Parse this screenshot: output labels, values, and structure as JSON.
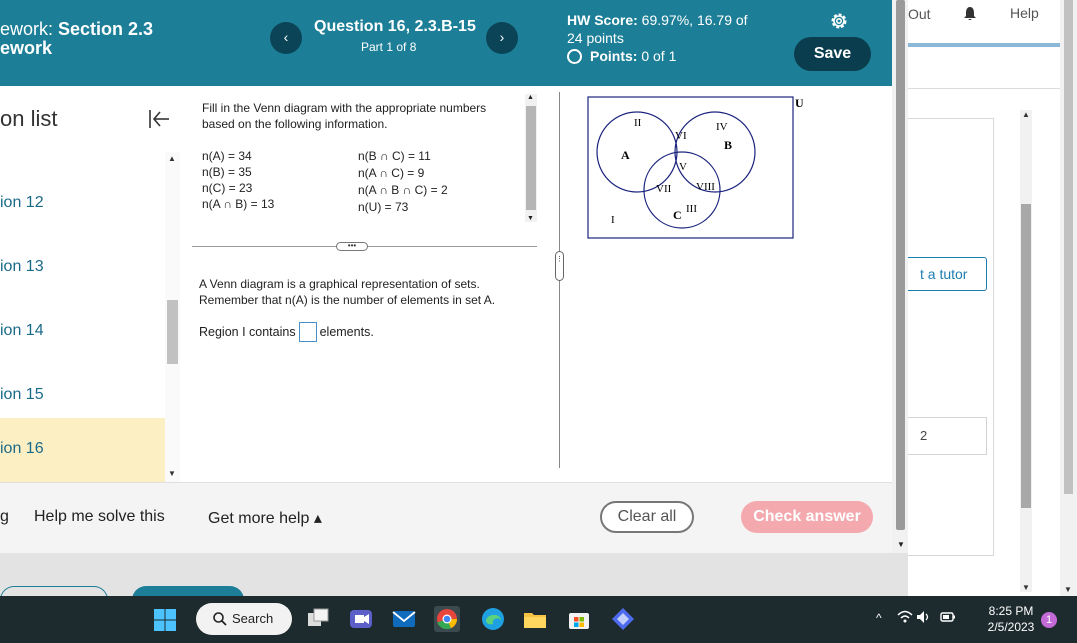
{
  "header": {
    "title_line1_prefix": "ework: ",
    "title_line1_section": "Section 2.3",
    "title_line2": "ework",
    "question_title": "Question 16, 2.3.B-15",
    "part": "Part 1 of 8",
    "prev_label": "‹",
    "next_label": "›",
    "hw_score_label": "HW Score:",
    "hw_score_value": " 69.97%, 16.79 of",
    "hw_points_total": "24 points",
    "points_label": "Points:",
    "points_value": " 0 of 1",
    "save_label": "Save"
  },
  "sidebar": {
    "title": "on list",
    "items": [
      {
        "label": "ion 12",
        "active": false
      },
      {
        "label": "ion 13",
        "active": false
      },
      {
        "label": "ion 14",
        "active": false
      },
      {
        "label": "ion 15",
        "active": false
      },
      {
        "label": "ion 16",
        "active": true
      }
    ]
  },
  "question": {
    "instruction_line1": "Fill in the Venn diagram with the appropriate numbers",
    "instruction_line2": "based on the following information.",
    "given_left": [
      "n(A) = 34",
      "n(B) = 35",
      "n(C) = 23",
      "n(A ∩ B) = 13"
    ],
    "given_right": [
      "n(B ∩ C) = 11",
      "n(A ∩ C) = 9",
      "n(A ∩ B ∩ C) = 2",
      "n(U) = 73"
    ],
    "more_label": "•••",
    "note_line1": "A Venn diagram is a graphical representation of sets.",
    "note_line2": "Remember that n(A) is the number of elements in set A.",
    "answer_prefix": "Region I contains",
    "answer_suffix": "elements.",
    "answer_value": ""
  },
  "venn": {
    "universe_label": "U",
    "set_labels": [
      "A",
      "B",
      "C"
    ],
    "regions": [
      "I",
      "II",
      "III",
      "IV",
      "V",
      "VI",
      "VII",
      "VIII"
    ]
  },
  "bottom": {
    "partial_left": "g",
    "help_solve": "Help me solve this",
    "more_help": "Get more help ▴",
    "clear_all": "Clear all",
    "check_answer": "Check answer"
  },
  "right_page": {
    "signout_partial": "Out",
    "help": "Help",
    "tutor_partial": "t a tutor",
    "box_partial": "2"
  },
  "taskbar": {
    "search_label": "Search",
    "time": "8:25 PM",
    "date": "2/5/2023",
    "notification_count": "1"
  },
  "colors": {
    "header_bg": "#1d7f97",
    "save_bg": "#0a3d4d",
    "active_item_bg": "#fcefc3",
    "check_answer_bg": "#f4a9ae",
    "taskbar_bg": "#1d2a2e"
  }
}
